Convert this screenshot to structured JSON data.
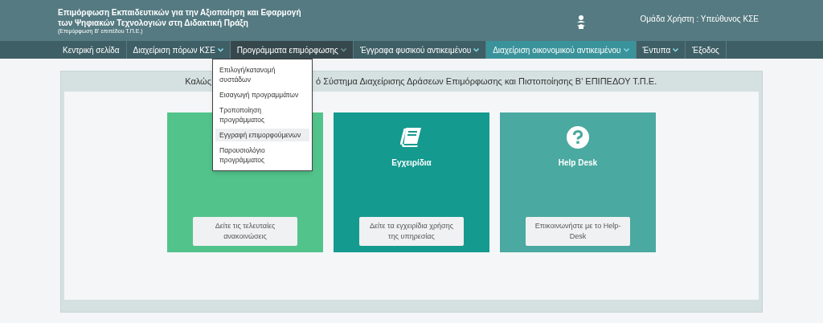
{
  "header": {
    "title_lines": [
      "Επιμόρφωση Εκπαιδευτικών για την Αξιοποίηση και Εφαρμογή",
      "των Ψηφιακών Τεχνολογιών στη Διδακτική Πράξη"
    ],
    "subtitle": "(Επιμόρφωση Β' επιπέδου Τ.Π.Ε.)",
    "user_group": "Ομάδα Χρήστη : Υπεύθυνος ΚΣΕ"
  },
  "nav": [
    {
      "label": "Κεντρική σελίδα",
      "has_menu": false,
      "open": false,
      "current": false
    },
    {
      "label": "Διαχείριση πόρων ΚΣΕ",
      "has_menu": true,
      "open": false,
      "current": false
    },
    {
      "label": "Προγράμματα επιμόρφωσης",
      "has_menu": true,
      "open": true,
      "current": false
    },
    {
      "label": "Έγγραφα φυσικού αντικειμένου",
      "has_menu": true,
      "open": false,
      "current": false
    },
    {
      "label": "Διαχείριση οικονομικού αντικειμένου",
      "has_menu": true,
      "open": false,
      "current": true
    },
    {
      "label": "Έντυπα",
      "has_menu": true,
      "open": false,
      "current": false
    },
    {
      "label": "Έξοδος",
      "has_menu": false,
      "open": false,
      "current": false
    }
  ],
  "dropdown": [
    {
      "label": "Επιλογή/κατανομή συστάδων",
      "selected": false
    },
    {
      "label": "Εισαγωγή προγραμμάτων",
      "selected": false
    },
    {
      "label": "Τροποποίηση προγράμματος",
      "selected": false
    },
    {
      "label": "Εγγραφή επιμορφούμενων",
      "selected": true
    },
    {
      "label": "Παρουσιολόγιο προγράμματος",
      "selected": false
    }
  ],
  "welcome": {
    "visible_start": "Καλώς",
    "visible_end": "ό Σύστημα Διαχείρισης Δράσεων Επιμόρφωσης και Πιστοποίησης Β' ΕΠΙΠΕΔΟΥ Τ.Π.Ε."
  },
  "cards": [
    {
      "kind": "covered",
      "color": "#52c38b",
      "button": "Δείτε τις τελευταίες ανακοινώσεις"
    },
    {
      "kind": "manuals",
      "color": "#159a8f",
      "title": "Εγχειρίδια",
      "button": "Δείτε τα εγχειρίδια χρήσης της υπηρεσίας"
    },
    {
      "kind": "help",
      "color": "#4aa9a0",
      "title": "Help Desk",
      "button": "Επικοινωνήστε με το Help-Desk"
    }
  ]
}
